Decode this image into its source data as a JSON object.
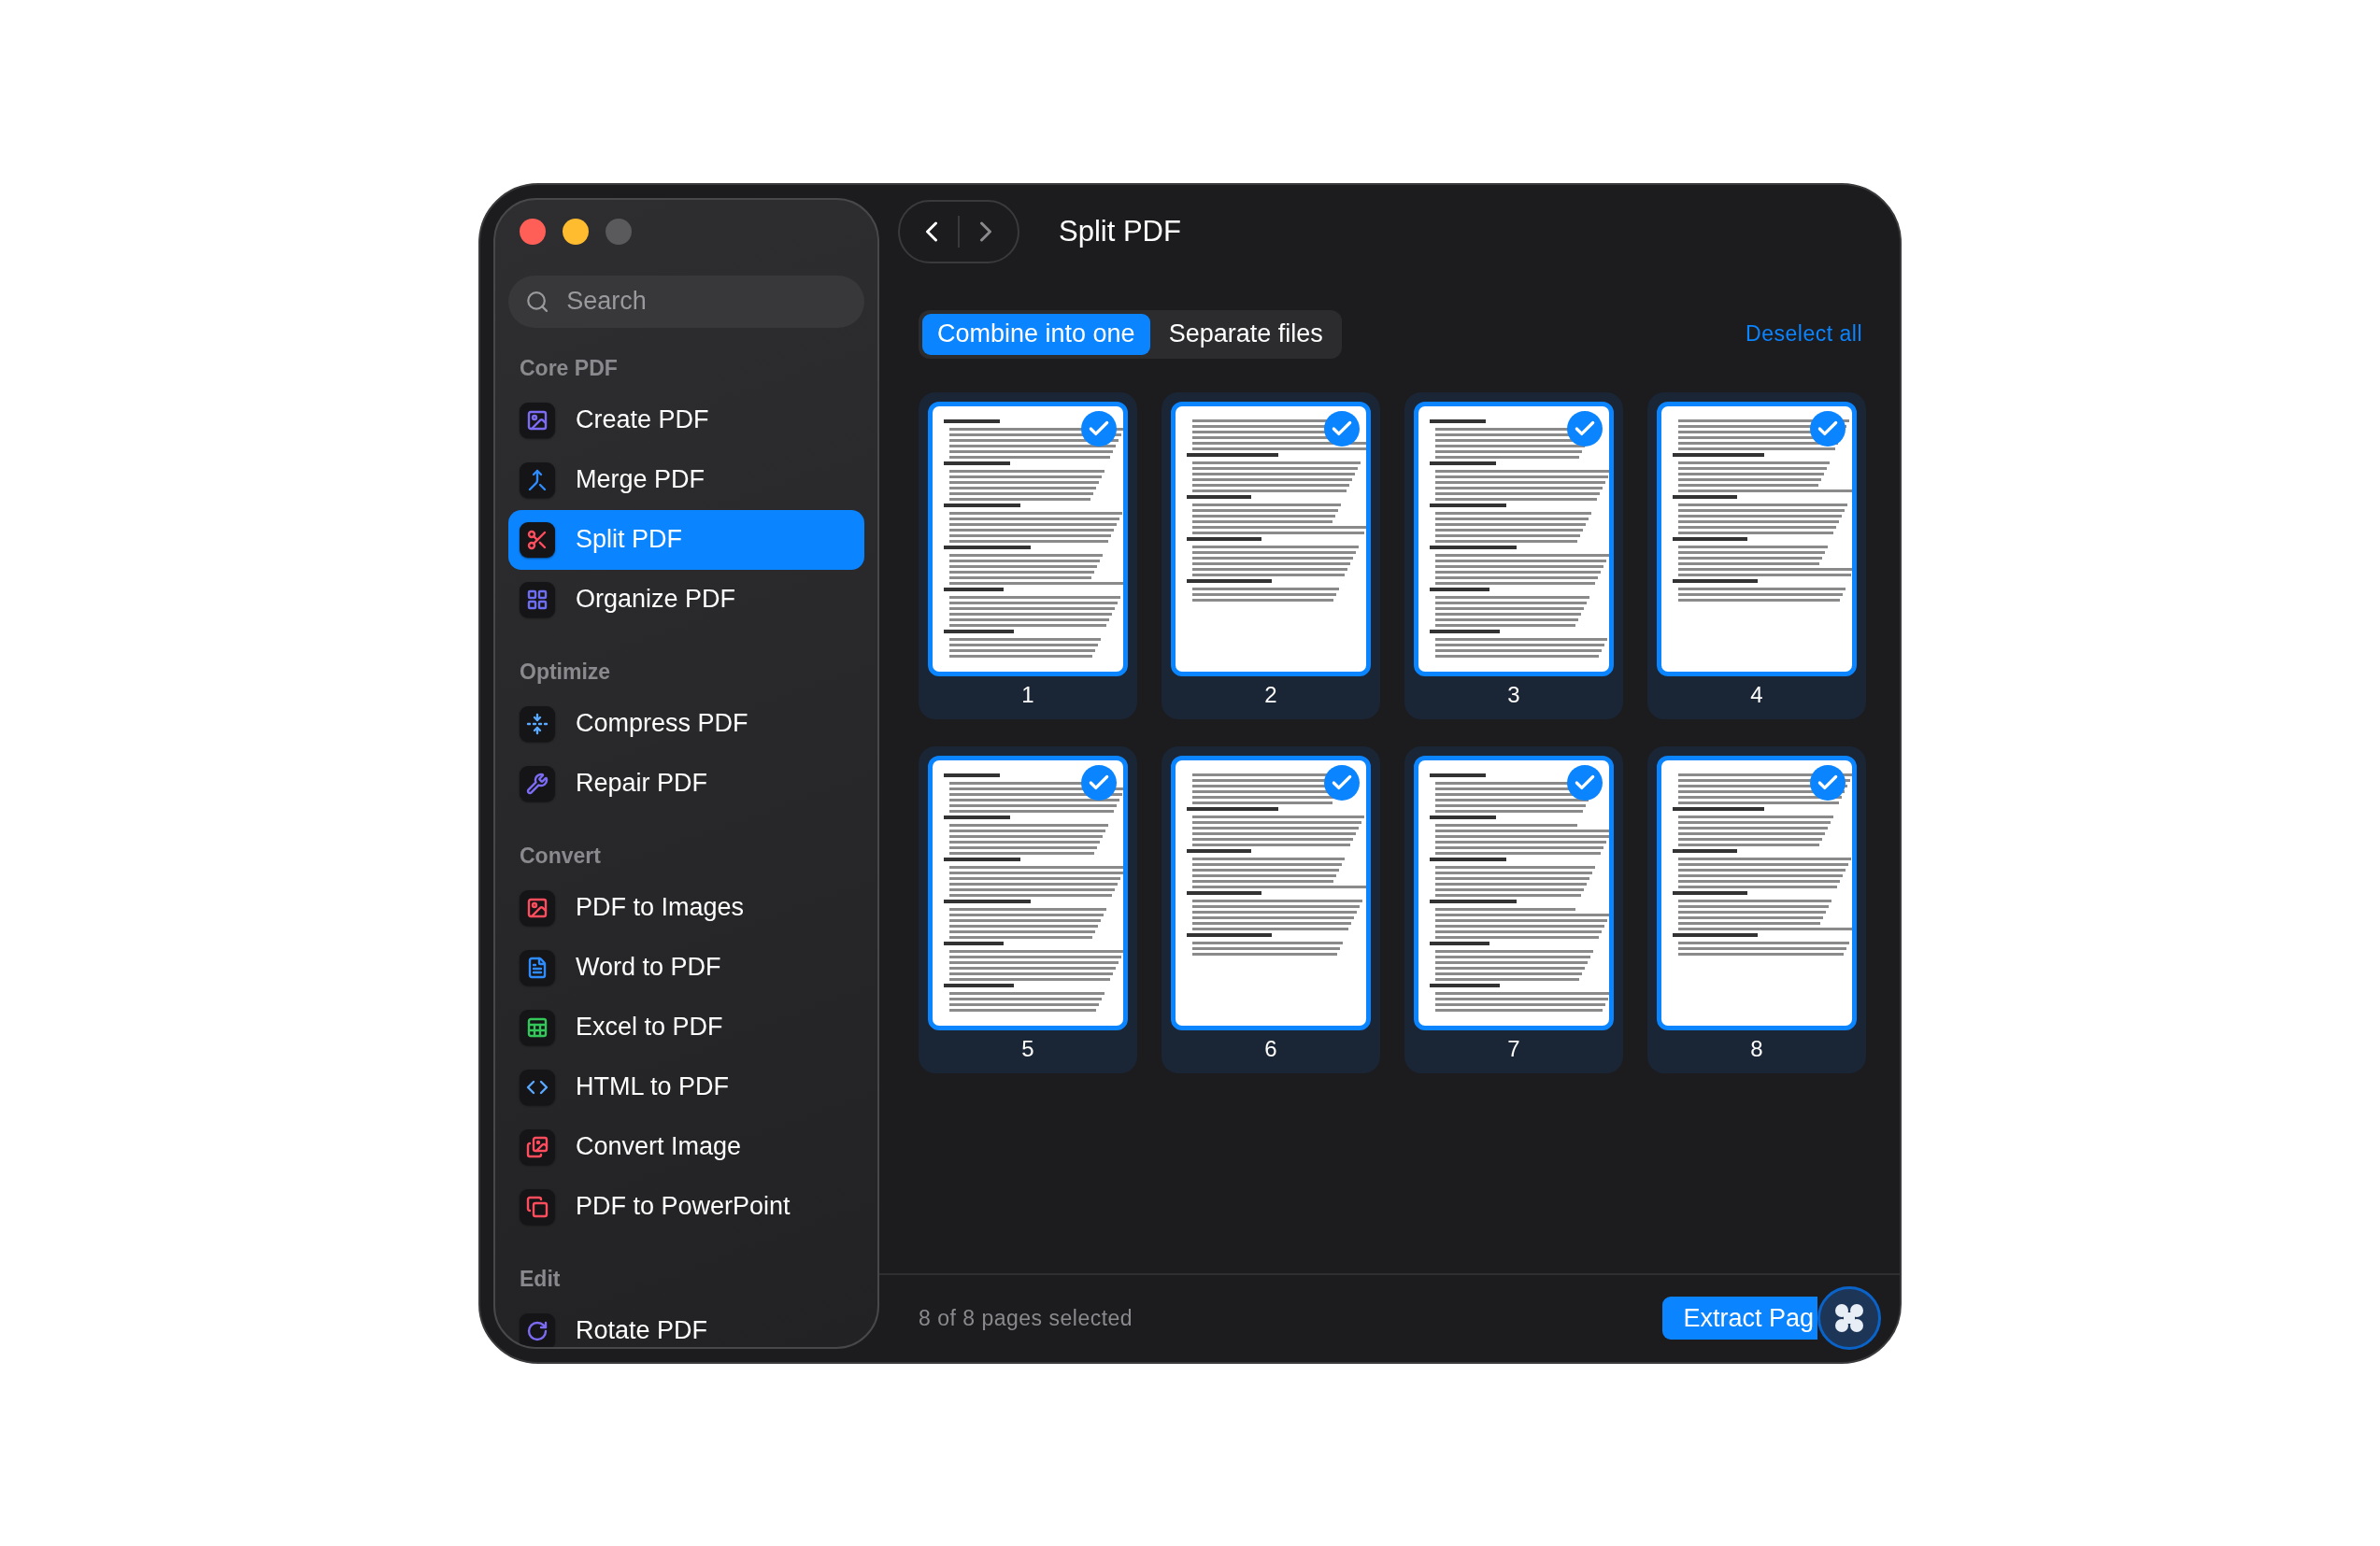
{
  "sidebar": {
    "search": {
      "placeholder": "Search"
    },
    "sections": [
      {
        "title": "Core PDF",
        "items": [
          {
            "label": "Create PDF",
            "selected": false
          },
          {
            "label": "Merge PDF",
            "selected": false
          },
          {
            "label": "Split PDF",
            "selected": true
          },
          {
            "label": "Organize PDF",
            "selected": false
          }
        ]
      },
      {
        "title": "Optimize",
        "items": [
          {
            "label": "Compress PDF",
            "selected": false
          },
          {
            "label": "Repair PDF",
            "selected": false
          }
        ]
      },
      {
        "title": "Convert",
        "items": [
          {
            "label": "PDF to Images",
            "selected": false
          },
          {
            "label": "Word to PDF",
            "selected": false
          },
          {
            "label": "Excel to PDF",
            "selected": false
          },
          {
            "label": "HTML to PDF",
            "selected": false
          },
          {
            "label": "Convert Image",
            "selected": false
          },
          {
            "label": "PDF to PowerPoint",
            "selected": false
          }
        ]
      },
      {
        "title": "Edit",
        "items": [
          {
            "label": "Rotate PDF",
            "selected": false
          }
        ]
      }
    ]
  },
  "header": {
    "title": "Split PDF",
    "back_disabled": false,
    "forward_disabled": true
  },
  "mode_tabs": [
    {
      "label": "Combine into one",
      "selected": true
    },
    {
      "label": "Separate files",
      "selected": false
    }
  ],
  "deselect_link": "Deselect all",
  "pages": [
    {
      "number": "1",
      "selected": true
    },
    {
      "number": "2",
      "selected": true
    },
    {
      "number": "3",
      "selected": true
    },
    {
      "number": "4",
      "selected": true
    },
    {
      "number": "5",
      "selected": true
    },
    {
      "number": "6",
      "selected": true
    },
    {
      "number": "7",
      "selected": true
    },
    {
      "number": "8",
      "selected": true
    }
  ],
  "footer": {
    "status": "8 of 8 pages selected",
    "primary_button": "Extract Pag"
  }
}
